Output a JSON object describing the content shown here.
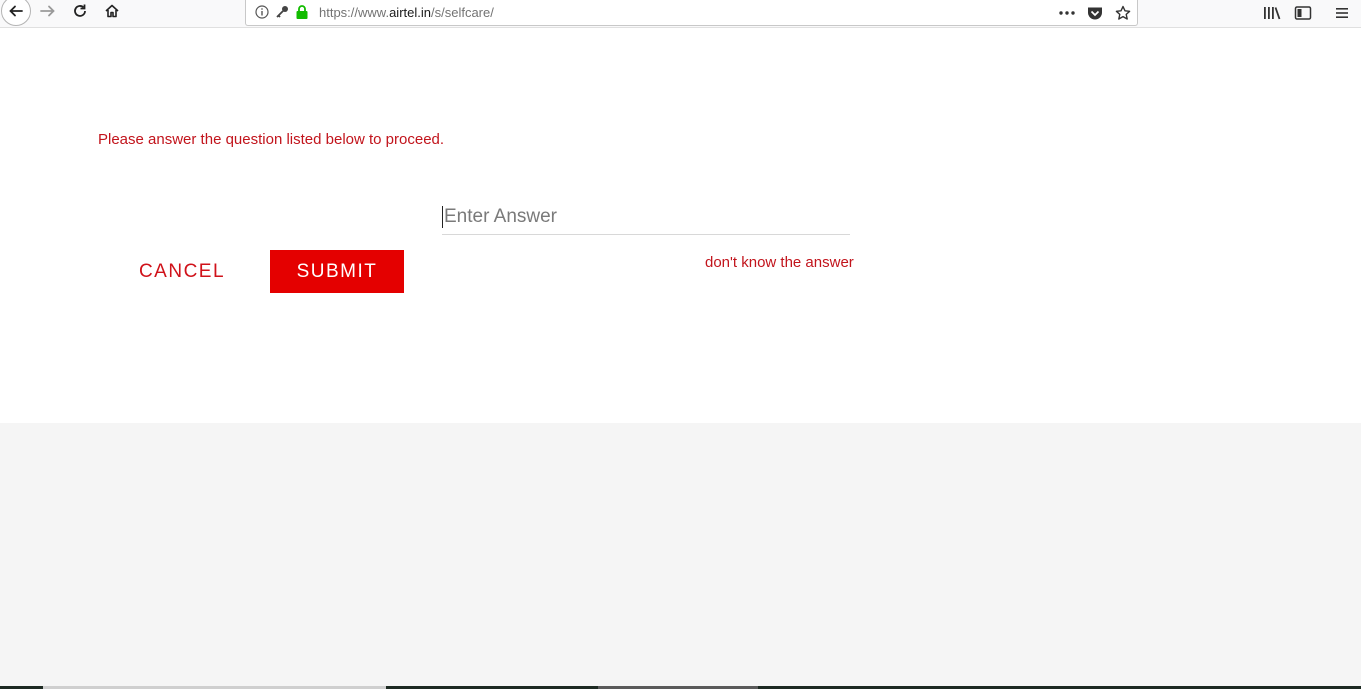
{
  "browser": {
    "url_prefix": "https://www.",
    "url_host": "airtel.in",
    "url_path": "/s/selfcare/"
  },
  "page": {
    "prompt": "Please answer the question listed below to proceed.",
    "answer_placeholder": "Enter Answer",
    "answer_value": "",
    "cancel_label": "CANCEL",
    "submit_label": "SUBMIT",
    "dont_know_label": "don't know the answer"
  },
  "colors": {
    "brand_red": "#e40000",
    "text_red": "#c2141c"
  }
}
